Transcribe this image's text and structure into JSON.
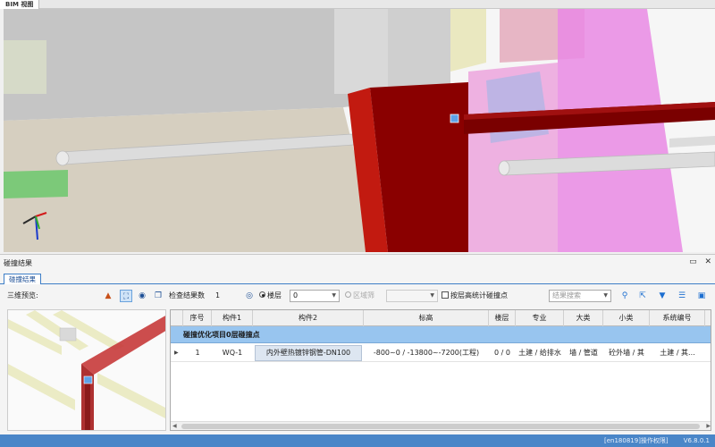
{
  "bim_view": {
    "tab_label": "BIM 视图"
  },
  "result_panel": {
    "title": "碰撞结果",
    "sub_tab": "碰撞结果",
    "preview_label": "三维预览:",
    "result_count_label": "检查结果数",
    "result_count": "1",
    "radio_floor": "楼层",
    "floor_select_value": "0",
    "radio_zone": "区域筛",
    "elevation_checkbox": "按层高统计碰撞点",
    "search_placeholder": "结果搜索"
  },
  "table": {
    "columns": [
      "序号",
      "构件1",
      "构件2",
      "标高",
      "楼层",
      "专业",
      "大类",
      "小类",
      "系统编号"
    ],
    "group_label": "碰撞优化项目0层碰撞点",
    "rows": [
      {
        "index": "1",
        "component1": "WQ-1",
        "component2": "内外壁热镀锌钢管-DN100",
        "elevation": "-800~0 / -13800~-7200(工程)",
        "floor": "0 / 0",
        "discipline": "土建 / 给排水",
        "category": "墙 / 管道",
        "subcategory": "砼外墙 / 其",
        "system_code": "土建 / 其..."
      }
    ]
  },
  "status_bar": {
    "user": "[en180819]操作权限]",
    "version": "V6.8.0.1"
  },
  "colors": {
    "accent": "#3e7ec7",
    "group_row": "#98c5ef",
    "status_bar": "#4a86c8",
    "collision_red": "#8a0000"
  }
}
